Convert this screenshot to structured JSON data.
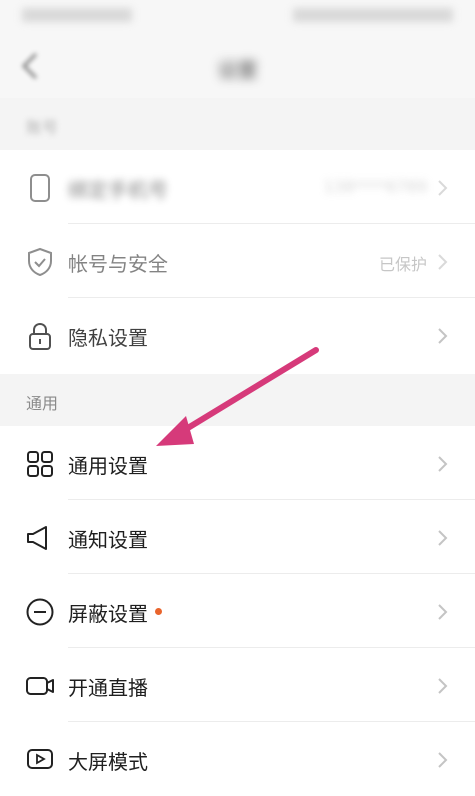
{
  "nav": {
    "title": "设置"
  },
  "sections": {
    "account": {
      "label": "账号"
    },
    "general": {
      "label": "通用"
    }
  },
  "rows": {
    "phone": {
      "label": "绑定手机号",
      "value": "138****6789"
    },
    "account_security": {
      "label": "帐号与安全",
      "value": "已保护"
    },
    "privacy": {
      "label": "隐私设置"
    },
    "general_settings": {
      "label": "通用设置"
    },
    "notification": {
      "label": "通知设置"
    },
    "block": {
      "label": "屏蔽设置"
    },
    "live": {
      "label": "开通直播"
    },
    "large_screen": {
      "label": "大屏模式"
    }
  },
  "colors": {
    "arrow": "#d63a7a",
    "badge": "#e9642c"
  },
  "icons": {
    "phone": "phone-icon",
    "security": "shield-icon",
    "privacy": "lock-icon",
    "general": "grid-icon",
    "notification": "speaker-icon",
    "block": "minus-circle-icon",
    "live": "video-camera-icon",
    "large_screen": "tv-icon",
    "chevron": "chevron-right-icon"
  }
}
